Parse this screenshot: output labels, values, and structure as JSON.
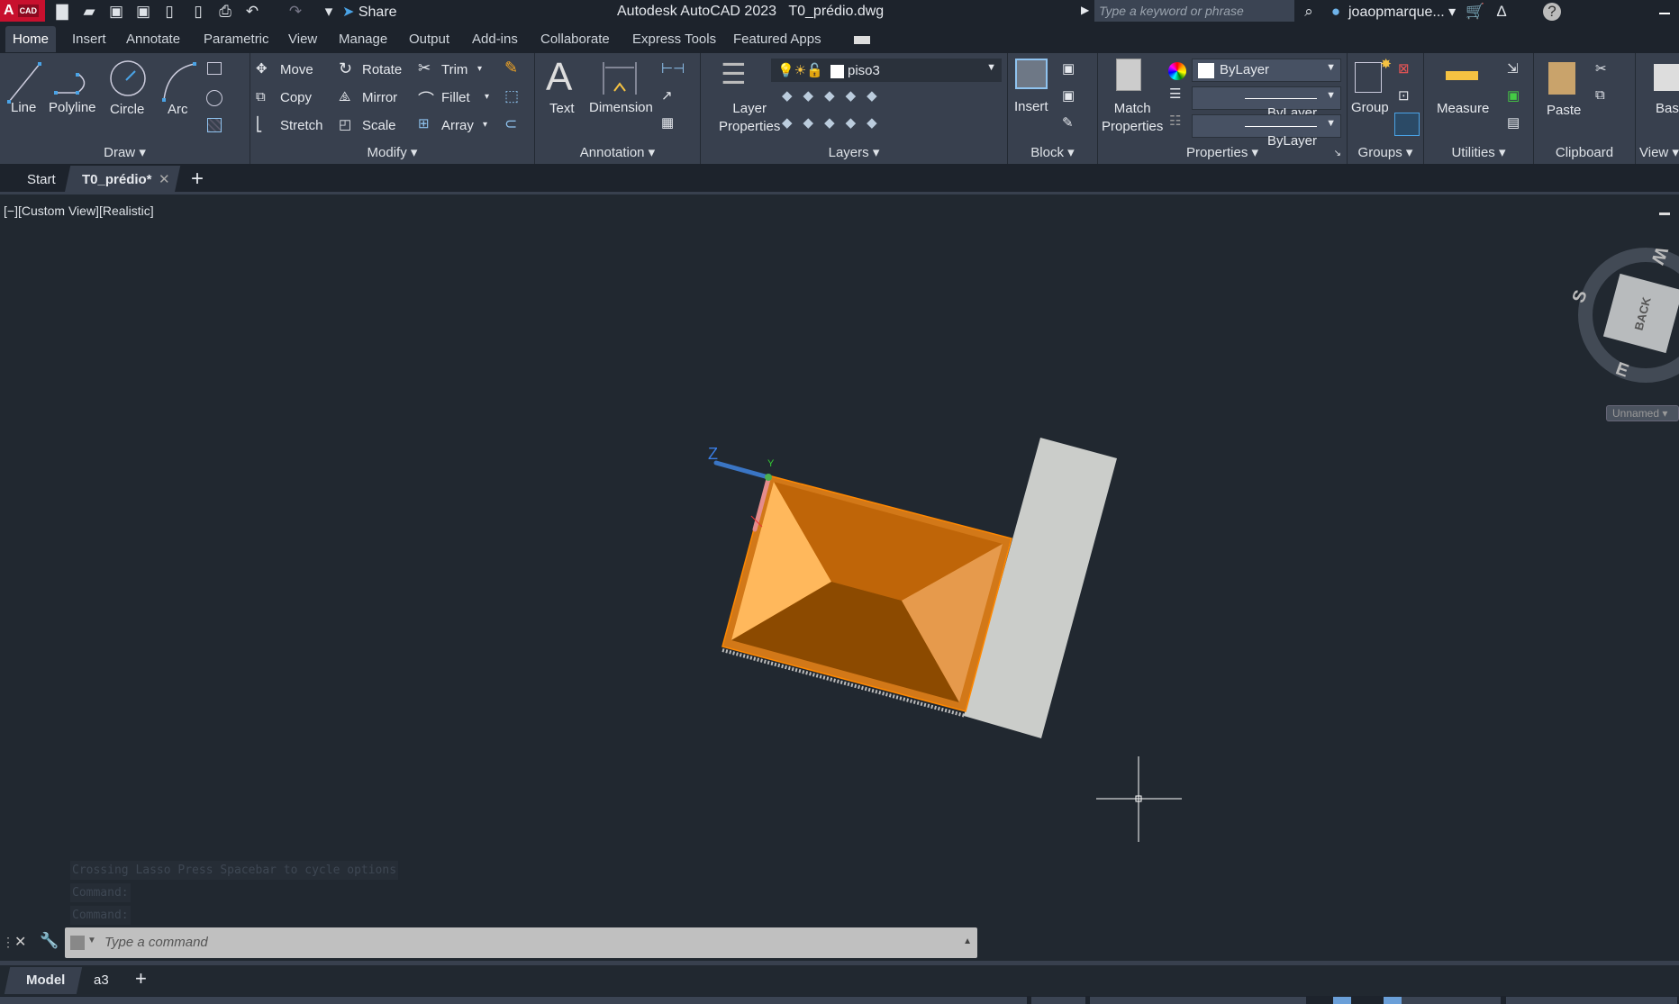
{
  "titlebar": {
    "logo": "A",
    "logo_sub": "CAD",
    "share": "Share",
    "app_title": "Autodesk AutoCAD 2023",
    "file_name": "T0_prédio.dwg",
    "search_placeholder": "Type a keyword or phrase",
    "user": "joaopmarque..."
  },
  "ribbon_tabs": [
    "Home",
    "Insert",
    "Annotate",
    "Parametric",
    "View",
    "Manage",
    "Output",
    "Add-ins",
    "Collaborate",
    "Express Tools",
    "Featured Apps"
  ],
  "draw": {
    "title": "Draw",
    "line": "Line",
    "polyline": "Polyline",
    "circle": "Circle",
    "arc": "Arc"
  },
  "modify": {
    "title": "Modify",
    "move": "Move",
    "rotate": "Rotate",
    "trim": "Trim",
    "copy": "Copy",
    "mirror": "Mirror",
    "fillet": "Fillet",
    "stretch": "Stretch",
    "scale": "Scale",
    "array": "Array"
  },
  "annotation": {
    "title": "Annotation",
    "text": "Text",
    "dimension": "Dimension"
  },
  "layers": {
    "title": "Layers",
    "layer_properties_1": "Layer",
    "layer_properties_2": "Properties",
    "current_layer": "piso3"
  },
  "block": {
    "title": "Block",
    "insert": "Insert"
  },
  "properties": {
    "title": "Properties",
    "match_1": "Match",
    "match_2": "Properties",
    "color": "ByLayer",
    "lineweight": "ByLayer",
    "linetype": "ByLayer"
  },
  "groups": {
    "title": "Groups",
    "group": "Group"
  },
  "utilities": {
    "title": "Utilities",
    "measure": "Measure"
  },
  "clipboard": {
    "title": "Clipboard",
    "paste": "Paste"
  },
  "view": {
    "title": "View",
    "base": "Base"
  },
  "doc_tabs": {
    "start": "Start",
    "active": "T0_prédio*"
  },
  "viewport": {
    "label": "[−][Custom View][Realistic]",
    "viewcube_face": "BACK",
    "compass_w": "W",
    "compass_s": "S",
    "compass_e": "E",
    "ucs_z": "Z",
    "ucs_y": "Y",
    "view_name": "Unnamed"
  },
  "command": {
    "history": [
      "Crossing Lasso  Press Spacebar to cycle options",
      "Command:",
      "Command:"
    ],
    "placeholder": "Type a command"
  },
  "layout_tabs": [
    "Model",
    "a3"
  ]
}
